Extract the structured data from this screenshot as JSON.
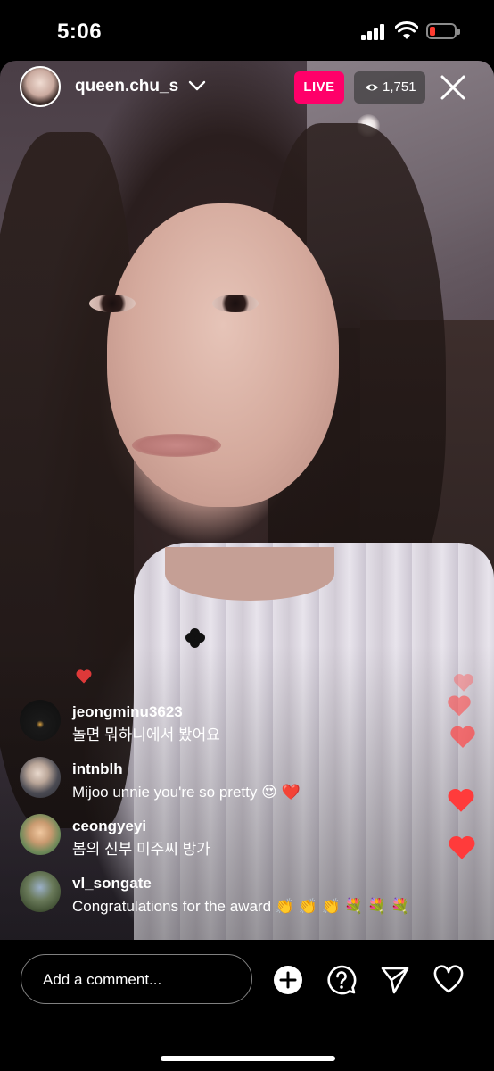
{
  "status": {
    "time": "5:06",
    "battery_color": "#ff3b30"
  },
  "header": {
    "host_name": "queen.chu_s",
    "live_label": "LIVE",
    "viewer_count": "1,751",
    "live_color": "#ff0069"
  },
  "comments": [
    {
      "user": "jeongminu3623",
      "message": "놀면 뭐하니에서 봤어요"
    },
    {
      "user": "intnblh",
      "message": "Mijoo unnie you're so pretty 😍 ❤️"
    },
    {
      "user": "ceongyeyi",
      "message": "봄의 신부 미주씨 방가"
    },
    {
      "user": "vl_songate",
      "message": "Congratulations for the award 👏 👏 👏 💐 💐 💐"
    }
  ],
  "composer": {
    "placeholder": "Add a comment..."
  },
  "icons": {
    "add": "plus-circle-icon",
    "question": "question-bubble-icon",
    "share": "send-icon",
    "like": "heart-icon",
    "close": "close-icon"
  }
}
